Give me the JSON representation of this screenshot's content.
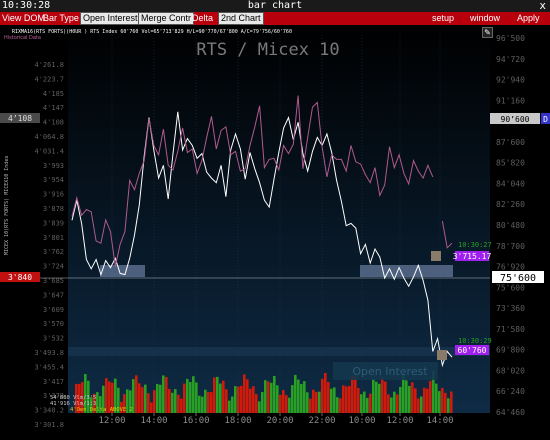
{
  "window": {
    "time": "10:30:28",
    "title": "bar chart",
    "close": "x"
  },
  "toolbar": {
    "view_dom": "View DOM",
    "bar_type": "Bar Type",
    "open_interest": "Open Interest",
    "merge_contr": "Merge Contr",
    "delta": "Delta",
    "second_chart": "2nd Chart",
    "setup": "setup",
    "window": "window",
    "apply": "Apply"
  },
  "colors": {
    "toolbar_red": "#b8000c",
    "rts_line": "#ffffff",
    "micex_line": "#b05a8e",
    "support_box": "#7a8fb5",
    "volume_red": "#d11a0a",
    "volume_green": "#29a023",
    "badge_purple": "#a020f0"
  },
  "chart_data": {
    "type": "line",
    "title": "RTS / Micex 10",
    "header": "RIXMA16(RTS FORTS)(H0UR ) RTS Index 60'760 Vol=65'713'829 H/L=90'770/67'800 A/C=79'756/60'760",
    "sub_header": "Historical Data",
    "left_ylabel": "MICEX 10(RTS FORTS) MICEX10 Index",
    "x_labels": [
      "12:00",
      "14:00",
      "16:00",
      "18:00",
      "20:00",
      "22:00",
      "10:00",
      "12:00",
      "14:00"
    ],
    "right_axis_labels": [
      "96'500",
      "94'720",
      "92'940",
      "91'160",
      "90'600",
      "87'600",
      "85'820",
      "84'040",
      "82'260",
      "80'480",
      "78'700",
      "76'920",
      "75'600",
      "73'360",
      "71'580",
      "69'800",
      "68'020",
      "66'240",
      "64'460"
    ],
    "left_axis_labels": [
      "4'261.8",
      "4'223.7",
      "4'185",
      "4'147",
      "4'108",
      "4'064.8",
      "4'031.4",
      "3'993",
      "3'954",
      "3'916",
      "3'878",
      "3'839",
      "3'801",
      "3'762",
      "3'724",
      "3'685",
      "3'647",
      "3'609",
      "3'570",
      "3'532",
      "3'493.8",
      "3'455.4",
      "3'417",
      "3'378",
      "3'340.2",
      "3'301.8"
    ],
    "yrange_right": [
      64000,
      96500
    ],
    "series": [
      {
        "name": "RTS Index",
        "values": [
          80580,
          82300,
          80300,
          77200,
          76400,
          77200,
          75900,
          77100,
          76500,
          77300,
          76000,
          75900,
          77300,
          79300,
          81900,
          86100,
          89400,
          86600,
          84200,
          85300,
          82400,
          86300,
          89900,
          86600,
          87600,
          87000,
          85900,
          86300,
          84700,
          84200,
          83800,
          85300,
          82600,
          86600,
          88000,
          86700,
          84100,
          86400,
          85000,
          83800,
          82300,
          81700,
          84100,
          86400,
          88500,
          89400,
          87500,
          89000,
          86300,
          84800,
          86500,
          87700,
          87000,
          88000,
          86400,
          84000,
          82200,
          80100,
          80300,
          79900,
          77700,
          78500,
          76900,
          78100,
          77400,
          75600,
          76400,
          75500,
          76500,
          75600,
          74900,
          75700,
          76700,
          75400,
          73700,
          69300,
          70400,
          68100,
          69300,
          68800
        ]
      },
      {
        "name": "MICEX 10",
        "values": [
          80900,
          82500,
          81000,
          81500,
          81300,
          78800,
          78600,
          80600,
          79600,
          76600,
          78500,
          79600,
          84000,
          83200,
          84600,
          85700,
          89300,
          87000,
          86200,
          88400,
          85300,
          84900,
          86500,
          88500,
          86400,
          86700,
          84600,
          85700,
          87700,
          89500,
          86700,
          88300,
          88600,
          86200,
          86500,
          84800,
          85000,
          87000,
          88600,
          90400,
          85100,
          85800,
          85900,
          84900,
          87000,
          86300,
          87100,
          91300,
          85000,
          87700,
          90300,
          90700,
          86900,
          84300,
          86200,
          85800,
          85800,
          84800,
          87000,
          85600,
          85400,
          84500,
          83800,
          85100,
          82700,
          83600,
          86900,
          85100,
          86200,
          84600,
          83700,
          85700,
          84800,
          84200,
          85300,
          84300,
          null,
          80500,
          78200,
          78600
        ]
      }
    ],
    "price_labels": {
      "current": "60'760",
      "rts_left_marker": "3'840",
      "micex_marker": "3'715.17",
      "time_stamp_1": "10:30:27",
      "time_stamp_2": "10:30:29",
      "highlight": "75'600",
      "d_marker": "D"
    },
    "volume": {
      "label": "Open Interest",
      "left_labels": [
        "54'880 Vlm/3'5",
        "41'916 Vlm/1:3",
        "4'Oen Delta ABOVE 2"
      ]
    },
    "grid": true
  }
}
